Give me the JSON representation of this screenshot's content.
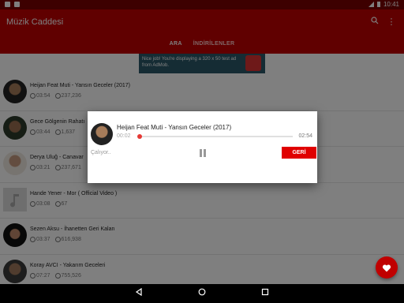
{
  "status_bar": {
    "time": "10:41"
  },
  "app": {
    "title": "Müzik Caddesi"
  },
  "tabs": [
    {
      "label": "ARA",
      "active": true
    },
    {
      "label": "İNDİRİLENLER",
      "active": false
    }
  ],
  "ad": {
    "text": "Nice job! You're displaying a 320 x 50 test ad from AdMob."
  },
  "songs": [
    {
      "title": "Heijan Feat Muti - Yansın Geceler (2017)",
      "duration": "03:54",
      "views": "237,236"
    },
    {
      "title": "Gece Gölgenin Rahatı",
      "duration": "03:44",
      "views": "1,637"
    },
    {
      "title": "Derya Uluğ - Canavar",
      "duration": "03:21",
      "views": "237,671"
    },
    {
      "title": "Hande Yener - Mor ( Official Video )",
      "duration": "03:08",
      "views": "67"
    },
    {
      "title": "Sezen Aksu - İhanetten Geri Kalan",
      "duration": "03:37",
      "views": "616,938"
    },
    {
      "title": "Koray AVCI - Yakarım Geceleri",
      "duration": "07:27",
      "views": "755,526"
    }
  ],
  "player": {
    "title": "Heijan Feat Muti - Yansın Geceler (2017)",
    "elapsed": "00:02",
    "duration": "02:54",
    "progress": 0.01,
    "state": "Çalıyor..",
    "back_label": "GERİ"
  },
  "colors": {
    "primary": "#c00000",
    "status": "#7a0000",
    "accent": "#e53935"
  },
  "icons": {
    "search": "search-icon",
    "overflow": "more-vert-icon",
    "favorite": "heart-icon",
    "pause": "pause-icon"
  }
}
